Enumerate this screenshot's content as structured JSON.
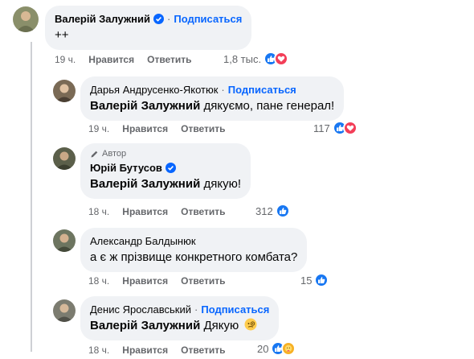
{
  "comments": [
    {
      "author": "Валерій Залужний",
      "verified": true,
      "follow_label": "Подписаться",
      "text": "++",
      "time": "19 ч.",
      "like_label": "Нравится",
      "reply_label": "Ответить",
      "reaction_count": "1,8 тыс.",
      "reactions": [
        "like-icon",
        "love-icon"
      ]
    },
    {
      "author": "Дарья Андрусенко-Якотюк",
      "follow_label": "Подписаться",
      "mention": "Валерій Залужний",
      "text": "дякуємо, пане генерал!",
      "time": "19 ч.",
      "like_label": "Нравится",
      "reply_label": "Ответить",
      "reaction_count": "117",
      "reactions": [
        "like-icon",
        "love-icon"
      ]
    },
    {
      "author_badge": "Автор",
      "author": "Юрій Бутусов",
      "verified": true,
      "mention": "Валерій Залужний",
      "text": "дякую!",
      "time": "18 ч.",
      "like_label": "Нравится",
      "reply_label": "Ответить",
      "reaction_count": "312",
      "reactions": [
        "like-icon"
      ]
    },
    {
      "author": "Александр Балдынюк",
      "text": "а є ж прізвище конкретного комбата?",
      "time": "18 ч.",
      "like_label": "Нравится",
      "reply_label": "Ответить",
      "reaction_count": "15",
      "reactions": [
        "like-icon"
      ]
    },
    {
      "author": "Денис Ярославський",
      "follow_label": "Подписаться",
      "mention": "Валерій Залужний",
      "text": "Дякую",
      "emoji": "face-with-monocle",
      "time": "18 ч.",
      "like_label": "Нравится",
      "reply_label": "Ответить",
      "reaction_count": "20",
      "reactions": [
        "like-icon",
        "care-icon"
      ]
    }
  ],
  "colors": {
    "bubble": "#f0f2f5",
    "link": "#0866ff",
    "secondary_text": "#65676b",
    "like": "#1877f2",
    "love": "#f33e58",
    "care": "#f7b125"
  }
}
